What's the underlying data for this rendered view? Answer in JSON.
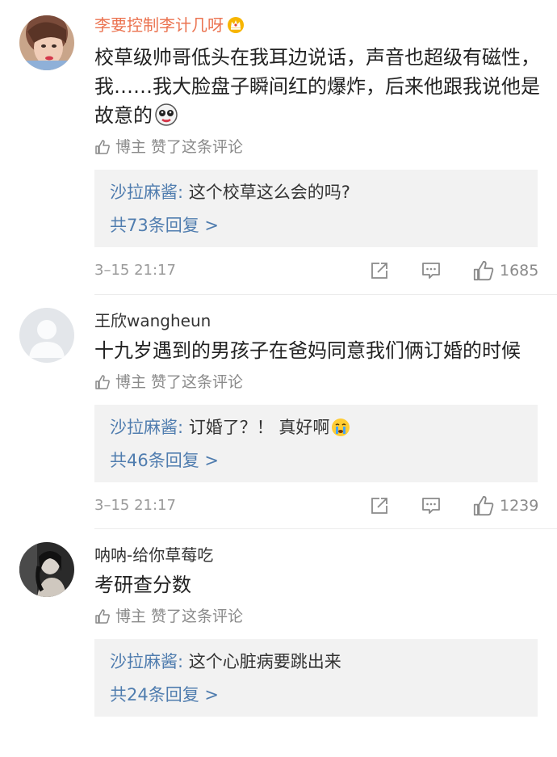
{
  "comments": [
    {
      "username": "李要控制李计几呀",
      "text": "校草级帅哥低头在我耳边说话，声音也超级有磁性，我……我大脸盘子瞬间红的爆炸，后来他跟我说他是故意的",
      "liked_by_author": "博主 赞了这条评论",
      "reply_user": "沙拉麻酱:",
      "reply_text": " 这个校草这么会的吗?",
      "reply_more": "共73条回复 >",
      "timestamp": "3–15 21:17",
      "like_count": "1685"
    },
    {
      "username": "王欣wangheun",
      "text": "十九岁遇到的男孩子在爸妈同意我们俩订婚的时候",
      "liked_by_author": "博主 赞了这条评论",
      "reply_user": "沙拉麻酱:",
      "reply_text": " 订婚了？！ 真好啊",
      "reply_more": "共46条回复 >",
      "timestamp": "3–15 21:17",
      "like_count": "1239"
    },
    {
      "username": "呐呐-给你草莓吃",
      "text": "考研查分数",
      "liked_by_author": "博主 赞了这条评论",
      "reply_user": "沙拉麻酱:",
      "reply_text": " 这个心脏病要跳出来",
      "reply_more": "共24条回复 >"
    }
  ],
  "colors": {
    "vip_name": "#eb7350",
    "link_blue": "#507daf",
    "muted": "#8a8a8a",
    "reply_bg": "#f2f2f2"
  },
  "icons": [
    "crown-icon",
    "thumbs-up-icon",
    "share-icon",
    "comment-icon",
    "like-icon",
    "skull-emoji-icon",
    "crying-emoji-icon"
  ]
}
